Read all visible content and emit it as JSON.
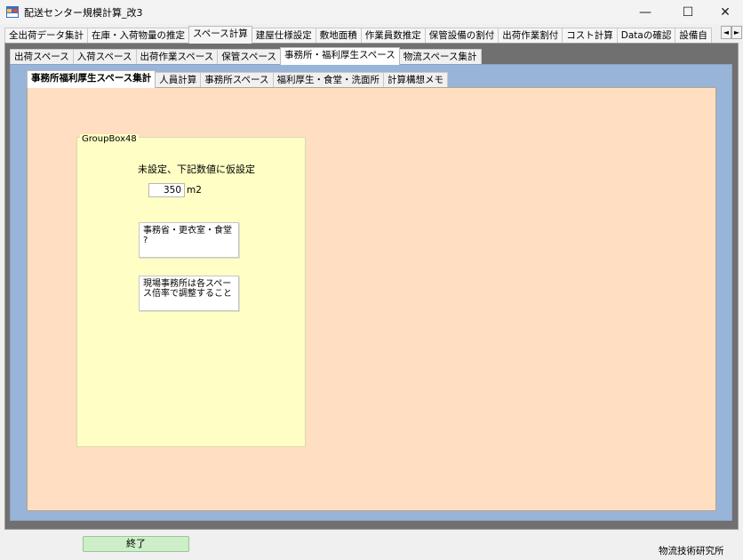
{
  "window": {
    "title": "配送センター規模計算_改3",
    "minimize": "—",
    "maximize": "☐",
    "close": "✕",
    "icon": "app-icon"
  },
  "tabs_main": [
    {
      "label": "全出荷データ集計",
      "active": false
    },
    {
      "label": "在庫・入荷物量の推定",
      "active": false
    },
    {
      "label": "スペース計算",
      "active": true
    },
    {
      "label": "建屋仕様設定",
      "active": false
    },
    {
      "label": "敷地面積",
      "active": false
    },
    {
      "label": "作業員数推定",
      "active": false
    },
    {
      "label": "保管設備の割付",
      "active": false
    },
    {
      "label": "出荷作業割付",
      "active": false
    },
    {
      "label": "コスト計算",
      "active": false
    },
    {
      "label": "Dataの確認",
      "active": false
    },
    {
      "label": "設備自",
      "active": false
    }
  ],
  "tab_scroll": {
    "left": "◄",
    "right": "►"
  },
  "tabs_space": [
    {
      "label": "出荷スペース",
      "active": false
    },
    {
      "label": "入荷スペース",
      "active": false
    },
    {
      "label": "出荷作業スペース",
      "active": false
    },
    {
      "label": "保管スペース",
      "active": false
    },
    {
      "label": "事務所・福利厚生スペース",
      "active": true
    },
    {
      "label": "物流スペース集計",
      "active": false
    }
  ],
  "tabs_office": [
    {
      "label": "事務所福利厚生スペース集計",
      "active": true
    },
    {
      "label": "人員計算",
      "active": false
    },
    {
      "label": "事務所スペース",
      "active": false
    },
    {
      "label": "福利厚生・食堂・洗面所",
      "active": false
    },
    {
      "label": "計算構想メモ",
      "active": false
    }
  ],
  "groupbox": {
    "title": "GroupBox48",
    "note": "未設定、下記数値に仮設定",
    "area_value": "350",
    "area_unit": "m2",
    "memo1": "事務省・更衣室・食堂\n?",
    "memo2": "現場事務所は各スペー\nス倍率で調整すること"
  },
  "footer": {
    "end_button": "終了",
    "company": "物流技術研究所"
  },
  "colors": {
    "panel_outer": "#707070",
    "panel_mid": "#98b4d8",
    "panel_inner": "#ffdec1",
    "groupbox": "#fefec5",
    "end_button": "#cdeec8"
  }
}
